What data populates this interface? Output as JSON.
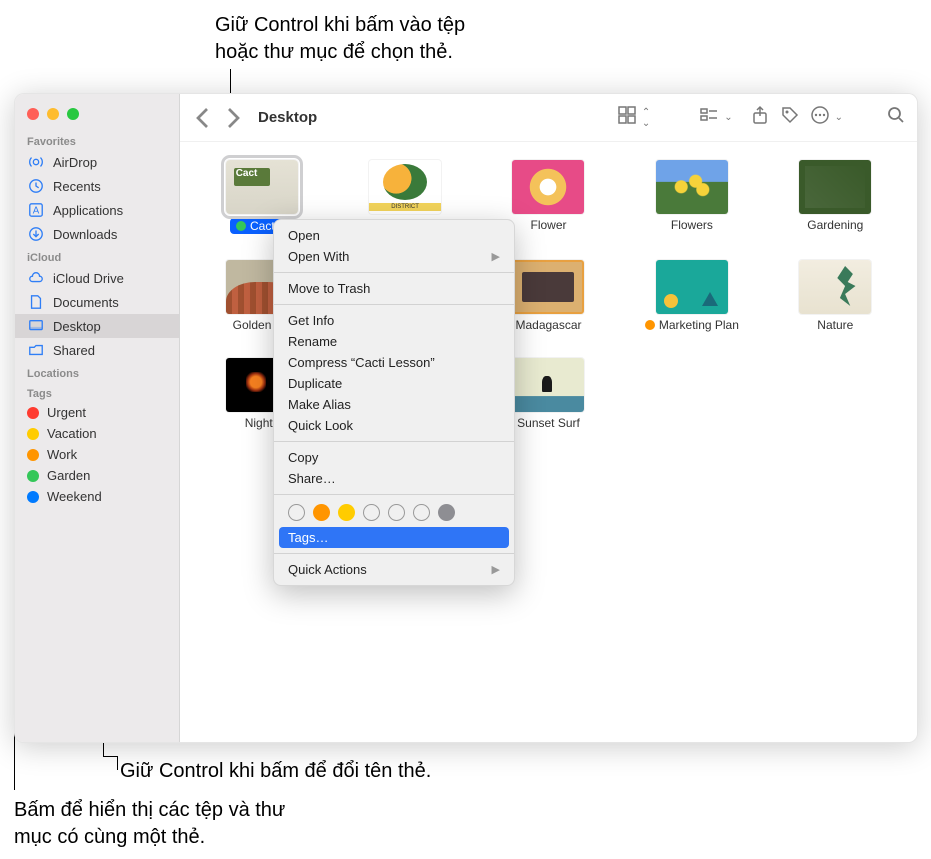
{
  "annotations": {
    "top_line1": "Giữ Control khi bấm vào tệp",
    "top_line2": "hoặc thư mục để chọn thẻ.",
    "middle": "Giữ Control khi bấm để đổi tên thẻ.",
    "bottom_line1": "Bấm để hiển thị các tệp và thư",
    "bottom_line2": "mục có cùng một thẻ."
  },
  "traffic_lights": {
    "close": "#ff5f57",
    "min": "#febc2e",
    "max": "#28c840"
  },
  "sidebar": {
    "favorites_header": "Favorites",
    "favorites": [
      {
        "label": "AirDrop",
        "icon": "airdrop"
      },
      {
        "label": "Recents",
        "icon": "clock"
      },
      {
        "label": "Applications",
        "icon": "apps"
      },
      {
        "label": "Downloads",
        "icon": "download"
      }
    ],
    "icloud_header": "iCloud",
    "icloud": [
      {
        "label": "iCloud Drive",
        "icon": "cloud"
      },
      {
        "label": "Documents",
        "icon": "doc"
      },
      {
        "label": "Desktop",
        "icon": "desktop",
        "active": true
      },
      {
        "label": "Shared",
        "icon": "shared"
      }
    ],
    "locations_header": "Locations",
    "tags_header": "Tags",
    "tags": [
      {
        "label": "Urgent",
        "color": "#ff3b30"
      },
      {
        "label": "Vacation",
        "color": "#ffcc00"
      },
      {
        "label": "Work",
        "color": "#ff9500"
      },
      {
        "label": "Garden",
        "color": "#34c759"
      },
      {
        "label": "Weekend",
        "color": "#007aff"
      }
    ]
  },
  "toolbar": {
    "title": "Desktop"
  },
  "items": [
    {
      "label": "Cacti L",
      "thumb": "th-cacti",
      "selected": true,
      "tag": "#34c759"
    },
    {
      "label": "",
      "thumb": "th-district"
    },
    {
      "label": "Flower",
      "thumb": "th-flower"
    },
    {
      "label": "Flowers",
      "thumb": "th-flowers"
    },
    {
      "label": "Gardening",
      "thumb": "th-garden"
    },
    {
      "label": "Golden Ga",
      "thumb": "th-golden"
    },
    {
      "label": "",
      "thumb": null
    },
    {
      "label": "Madagascar",
      "thumb": "th-mad"
    },
    {
      "label": "Marketing Plan",
      "thumb": "th-market",
      "tag": "#ff9500"
    },
    {
      "label": "Nature",
      "thumb": "th-nature"
    },
    {
      "label": "Nightti",
      "thumb": "th-night"
    },
    {
      "label": "",
      "thumb": null
    },
    {
      "label": "Sunset Surf",
      "thumb": "th-sunset"
    }
  ],
  "context_menu": {
    "open": "Open",
    "open_with": "Open With",
    "trash": "Move to Trash",
    "info": "Get Info",
    "rename": "Rename",
    "compress": "Compress “Cacti Lesson”",
    "duplicate": "Duplicate",
    "alias": "Make Alias",
    "quicklook": "Quick Look",
    "copy": "Copy",
    "share": "Share…",
    "tags_label": "Tags…",
    "quick_actions": "Quick Actions",
    "tag_colors": [
      "none",
      "#ff9500",
      "#ffcc00",
      "none",
      "none",
      "none",
      "#8e8e93"
    ]
  }
}
